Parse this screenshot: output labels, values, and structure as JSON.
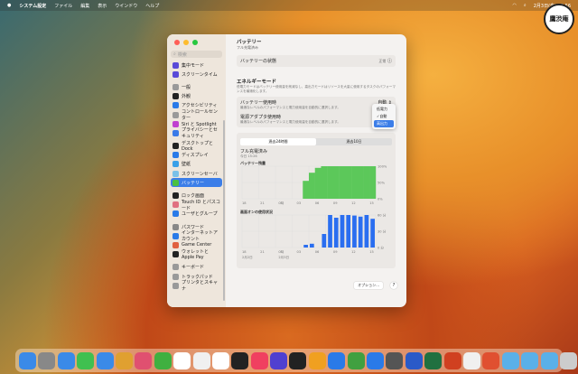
{
  "menubar": {
    "apple": "",
    "items": [
      "システム設定",
      "ファイル",
      "編集",
      "表示",
      "ウインドウ",
      "ヘルプ"
    ],
    "clock": "2月3日(金) 15:56"
  },
  "logo": {
    "text": "鷹渋庵"
  },
  "sidebar": {
    "search_placeholder": "検索",
    "groups": [
      [
        {
          "label": "集中モード",
          "color": "#5a4ad8"
        },
        {
          "label": "スクリーンタイム",
          "color": "#5a4ad8"
        }
      ],
      [
        {
          "label": "一般",
          "color": "#999"
        },
        {
          "label": "外観",
          "color": "#222"
        },
        {
          "label": "アクセシビリティ",
          "color": "#2a7ae8"
        },
        {
          "label": "コントロールセンター",
          "color": "#999"
        },
        {
          "label": "Siri と Spotlight",
          "color": "#c040d0"
        },
        {
          "label": "プライバシーとセキュリティ",
          "color": "#3a7ae8"
        }
      ],
      [
        {
          "label": "デスクトップと Dock",
          "color": "#222"
        },
        {
          "label": "ディスプレイ",
          "color": "#2a7ae8"
        },
        {
          "label": "壁紙",
          "color": "#3aa0e8"
        },
        {
          "label": "スクリーンセーバ",
          "color": "#7ac0e8"
        },
        {
          "label": "バッテリー",
          "color": "#4ac040",
          "selected": true
        }
      ],
      [
        {
          "label": "ロック画面",
          "color": "#222"
        },
        {
          "label": "Touch ID とパスコード",
          "color": "#e07080"
        },
        {
          "label": "ユーザとグループ",
          "color": "#2a7ae8"
        }
      ],
      [
        {
          "label": "パスワード",
          "color": "#888"
        },
        {
          "label": "インターネットアカウント",
          "color": "#2a7ae8"
        },
        {
          "label": "Game Center",
          "color": "#e06040"
        },
        {
          "label": "ウォレットと Apple Pay",
          "color": "#222"
        }
      ],
      [
        {
          "label": "キーボード",
          "color": "#999"
        },
        {
          "label": "トラックパッド",
          "color": "#999"
        },
        {
          "label": "プリンタとスキャナ",
          "color": "#999"
        }
      ]
    ]
  },
  "main": {
    "title": "バッテリー",
    "subtitle": "フル充電済み",
    "status_label": "バッテリーの状態",
    "status_value": "正常",
    "energy_title": "エネルギーモード",
    "energy_desc": "低電力モードはバッテリー使用量を削減なし、高出力モードはリソースを大量に使用するタスクのパフォーマンスを最適化します。",
    "battery_mode_label": "バッテリー使用時",
    "battery_mode_value": "自動",
    "battery_mode_desc": "最適なレベルのパフォーマンスと電力使用量を自動的に選択します。",
    "adapter_mode_label": "電源アダプタ使用時",
    "adapter_mode_desc": "最適なレベルのパフォーマンスと電力使用量を自動的に選択します。",
    "popup": [
      "低電力",
      "自動",
      "高出力"
    ],
    "popup_checked": "自動",
    "popup_highlight": "高出力",
    "tabs": [
      "過去24時間",
      "過去10日"
    ],
    "active_tab": "過去24時間",
    "charged_label": "フル充電済み",
    "charged_time": "今日 15:26",
    "options_button": "オプション...",
    "help": "?"
  },
  "chart_data": [
    {
      "type": "area",
      "title": "バッテリー残量",
      "x_ticks": [
        "18",
        "21",
        "0時",
        "03",
        "06",
        "09",
        "12",
        "15"
      ],
      "y_ticks": [
        "100%",
        "50%",
        "0%"
      ],
      "ylim": [
        0,
        100
      ],
      "color": "#5cc85a",
      "hours": [
        18,
        19,
        20,
        21,
        22,
        23,
        0,
        1,
        2,
        3,
        4,
        5,
        6,
        7,
        8,
        9,
        10,
        11,
        12,
        13,
        14,
        15
      ],
      "values": [
        null,
        null,
        null,
        null,
        null,
        null,
        null,
        null,
        null,
        null,
        55,
        80,
        95,
        100,
        100,
        100,
        100,
        100,
        100,
        100,
        100,
        100
      ]
    },
    {
      "type": "bar",
      "title": "画面オンの使用状況",
      "x_ticks": [
        "18",
        "21",
        "0時",
        "03",
        "06",
        "09",
        "12",
        "15"
      ],
      "date_labels": [
        "2月2日",
        "2月3日"
      ],
      "y_ticks": [
        "60 分",
        "30 分",
        "0 分"
      ],
      "ylim": [
        0,
        60
      ],
      "color": "#2a6ef0",
      "hours": [
        18,
        19,
        20,
        21,
        22,
        23,
        0,
        1,
        2,
        3,
        4,
        5,
        6,
        7,
        8,
        9,
        10,
        11,
        12,
        13,
        14,
        15
      ],
      "values": [
        0,
        0,
        0,
        0,
        0,
        0,
        0,
        0,
        0,
        0,
        5,
        7,
        0,
        25,
        60,
        55,
        60,
        60,
        59,
        57,
        60,
        53
      ]
    }
  ],
  "dock": {
    "colors": [
      "#3a8ae8",
      "#888",
      "#3a8ae8",
      "#40c050",
      "#3a8ae8",
      "#e0a030",
      "#e05070",
      "#40b040",
      "#fff",
      "#f0f0f0",
      "#fff",
      "#222",
      "#f04060",
      "#5040d0",
      "#222",
      "#f0a020",
      "#2a7ae8",
      "#40a040",
      "#2a7ae8",
      "#555",
      "#2a5ac8",
      "#207040",
      "#d04020",
      "#f0f0f0",
      "#e05030",
      "#5ab0e8",
      "#5ab0e8",
      "#5ab0e8",
      "#ccc"
    ]
  }
}
